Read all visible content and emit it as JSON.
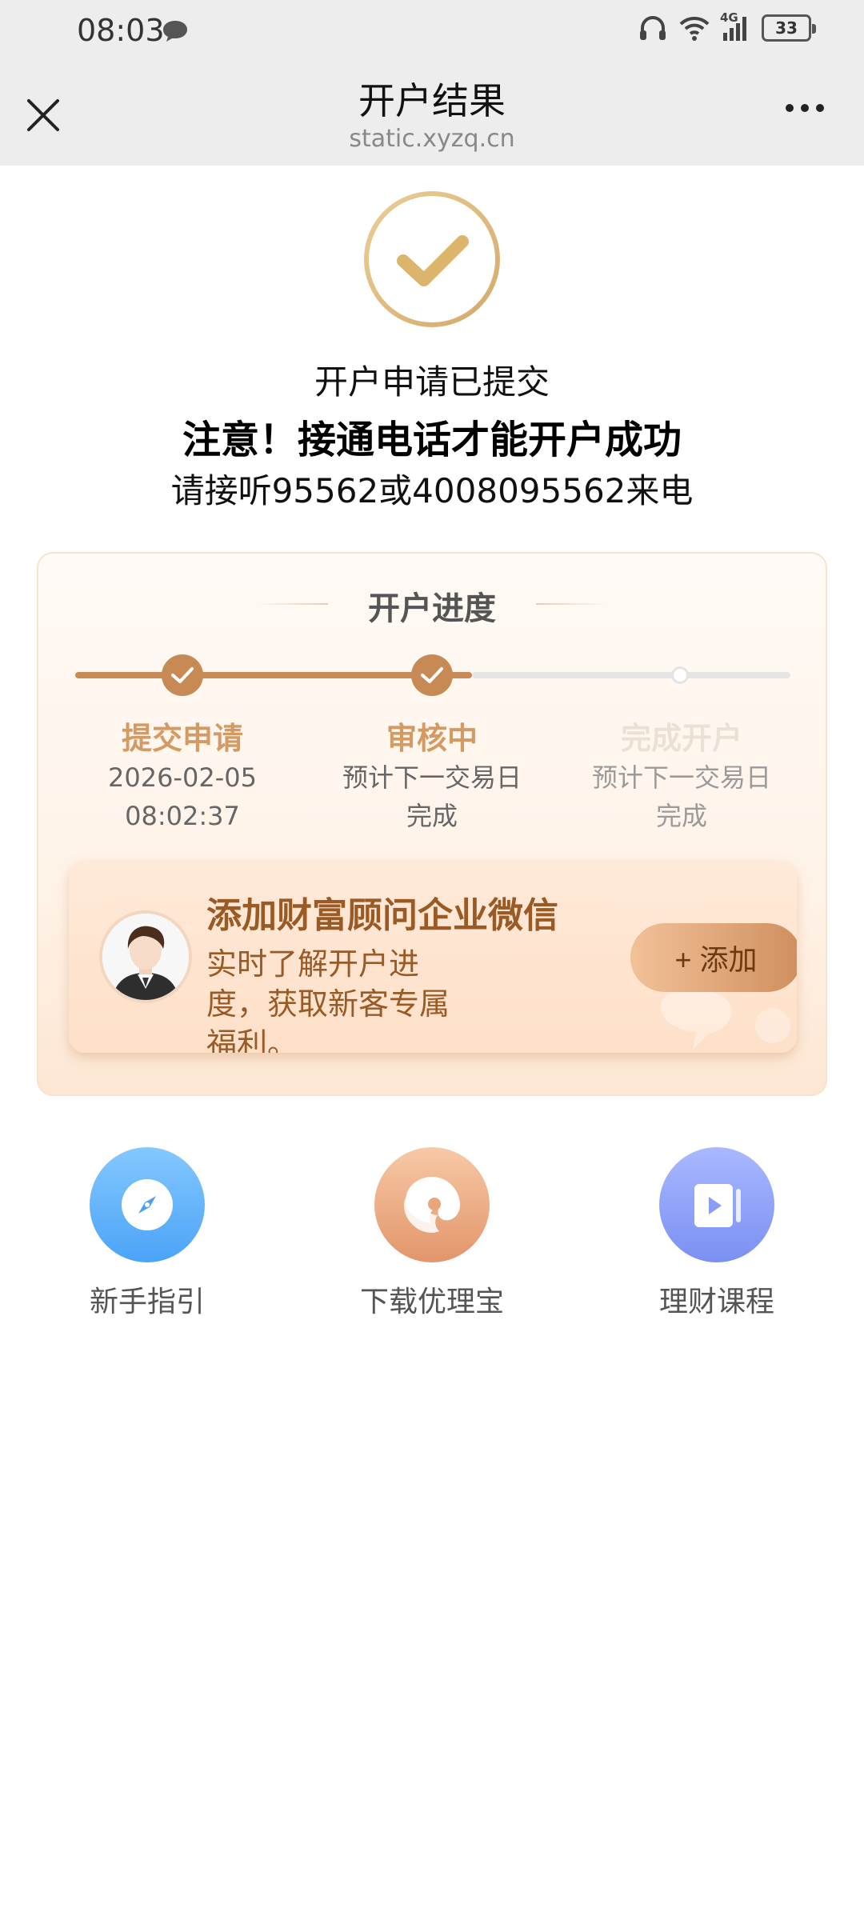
{
  "status_bar": {
    "time": "08:03",
    "network": "4G",
    "battery": "33"
  },
  "header": {
    "title": "开户结果",
    "url": "static.xyzq.cn"
  },
  "result": {
    "submitted": "开户申请已提交",
    "notice": "注意！接通电话才能开户成功",
    "phone_note": "请接听95562或4008095562来电"
  },
  "progress": {
    "title": "开户进度",
    "steps": [
      {
        "label": "提交申请",
        "line1": "2026-02-05",
        "line2": "08:02:37",
        "state": "done"
      },
      {
        "label": "审核中",
        "line1": "预计下一交易日",
        "line2": "完成",
        "state": "current"
      },
      {
        "label": "完成开户",
        "line1": "预计下一交易日",
        "line2": "完成",
        "state": "pending"
      }
    ]
  },
  "wechat": {
    "title": "添加财富顾问企业微信",
    "desc": "实时了解开户进度，获取新客专属福利。",
    "button": "+ 添加"
  },
  "shortcuts": [
    {
      "label": "新手指引",
      "icon": "compass-icon"
    },
    {
      "label": "下载优理宝",
      "icon": "app-logo-icon"
    },
    {
      "label": "理财课程",
      "icon": "video-course-icon"
    }
  ],
  "colors": {
    "accent": "#c88a55",
    "accent_text": "#d39a63",
    "topbar": "#ededed"
  }
}
